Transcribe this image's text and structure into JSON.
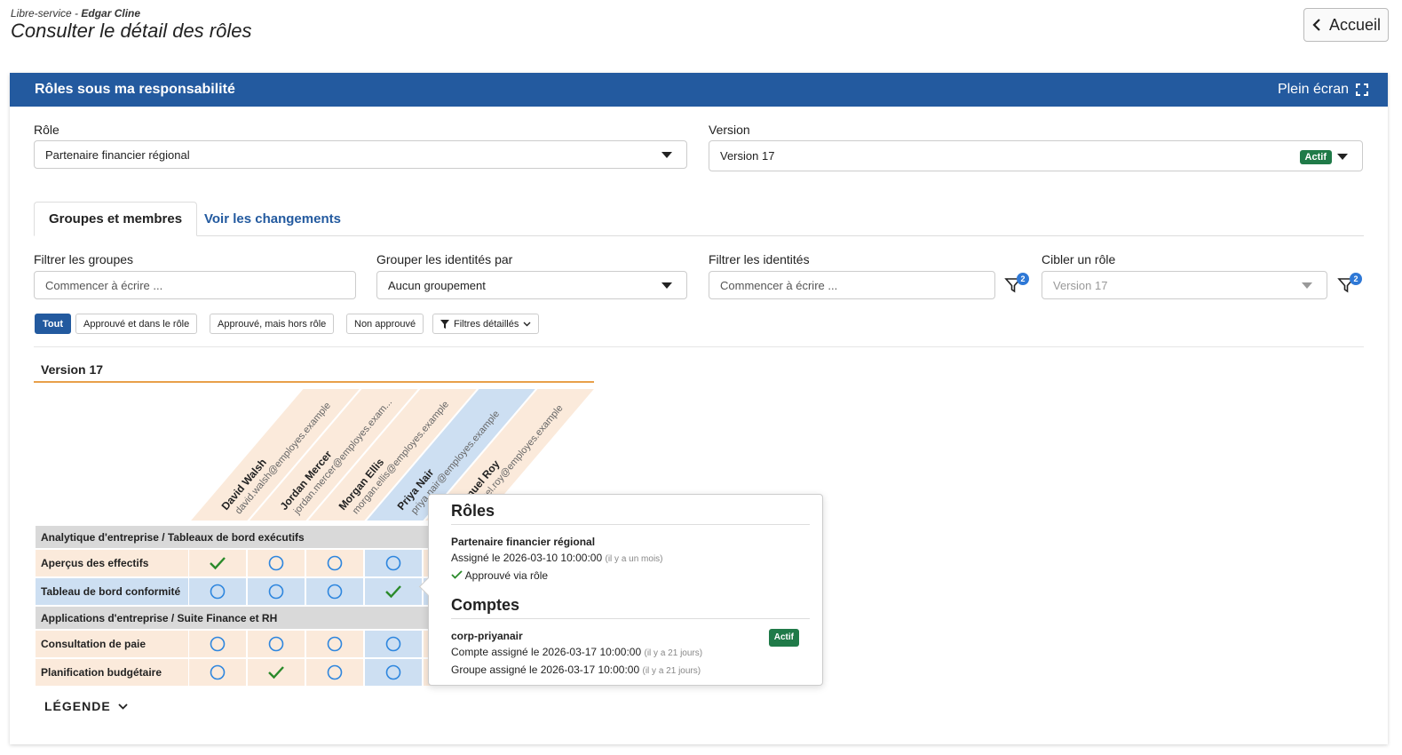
{
  "header": {
    "crumb_prefix": "Libre-service - ",
    "crumb_user": "Edgar Cline",
    "title": "Consulter le détail des rôles",
    "home_label": "Accueil"
  },
  "panel": {
    "title": "Rôles sous ma responsabilité",
    "fullscreen_label": "Plein écran"
  },
  "role_select": {
    "label": "Rôle",
    "value": "Partenaire financier régional"
  },
  "version_select": {
    "label": "Version",
    "value": "Version 17",
    "badge": "Actif"
  },
  "tabs": [
    {
      "label": "Groupes et membres",
      "active": true
    },
    {
      "label": "Voir les changements",
      "active": false
    }
  ],
  "filters": {
    "groups": {
      "label": "Filtrer les groupes",
      "placeholder": "Commencer à écrire ..."
    },
    "group_by": {
      "label": "Grouper les identités par",
      "value": "Aucun groupement"
    },
    "identities": {
      "label": "Filtrer les identités",
      "placeholder": "Commencer à écrire ...",
      "count": "2"
    },
    "target": {
      "label": "Cibler un rôle",
      "value": "Version 17",
      "count": "2"
    }
  },
  "chips": [
    {
      "label": "Tout",
      "active": true
    },
    {
      "label": "Approuvé et dans le rôle",
      "active": false
    },
    {
      "label": "Approuvé, mais hors rôle",
      "active": false
    },
    {
      "label": "Non approuvé",
      "active": false
    },
    {
      "label": "Filtres détaillés",
      "active": false
    }
  ],
  "version_heading": "Version 17",
  "columns": [
    {
      "name": "David Walsh",
      "email": "david.walsh@employes.example",
      "highlight": false
    },
    {
      "name": "Jordan Mercer",
      "email": "jordan.mercer@employes.exam...",
      "highlight": false
    },
    {
      "name": "Morgan Ellis",
      "email": "morgan.ellis@employes.example",
      "highlight": false
    },
    {
      "name": "Priya Nair",
      "email": "priya.nair@employes.example",
      "highlight": true
    },
    {
      "name": "Samuel Roy",
      "email": "samuel.roy@employes.example",
      "highlight": false
    }
  ],
  "groups": [
    {
      "title": "Analytique d'entreprise / Tableaux de bord exécutifs",
      "rows": [
        {
          "label": "Aperçus des effectifs",
          "highlight": false,
          "cells": [
            "check",
            "circle",
            "circle",
            "circle",
            "circle"
          ]
        },
        {
          "label": "Tableau de bord conformité",
          "highlight": true,
          "cells": [
            "circle",
            "circle",
            "circle",
            "check",
            "circle"
          ]
        }
      ]
    },
    {
      "title": "Applications d'entreprise / Suite Finance et RH",
      "rows": [
        {
          "label": "Consultation de paie",
          "highlight": false,
          "cells": [
            "circle",
            "circle",
            "circle",
            "circle",
            "circle"
          ]
        },
        {
          "label": "Planification budgétaire",
          "highlight": false,
          "cells": [
            "circle",
            "check",
            "circle",
            "circle",
            "circle"
          ]
        }
      ]
    }
  ],
  "legend_label": "LÉGENDE",
  "popover": {
    "roles_heading": "Rôles",
    "role_name": "Partenaire financier régional",
    "role_assigned": "Assigné le 2026-03-10 10:00:00",
    "role_assigned_rel": "(il y a un mois)",
    "role_approved": "Approuvé via rôle",
    "accounts_heading": "Comptes",
    "account_name": "corp-priyanair",
    "account_badge": "Actif",
    "account_assigned": "Compte assigné le 2026-03-17 10:00:00",
    "account_assigned_rel": "(il y a 21 jours)",
    "group_assigned": "Groupe assigné le 2026-03-17 10:00:00",
    "group_assigned_rel": "(il y a 21 jours)"
  },
  "colors": {
    "accent": "#235a9f",
    "check": "#2a8a2a",
    "circle": "#2e86de",
    "row_orange": "#fbeadb",
    "row_blue": "#cddff2",
    "underline": "#e8a04a"
  }
}
